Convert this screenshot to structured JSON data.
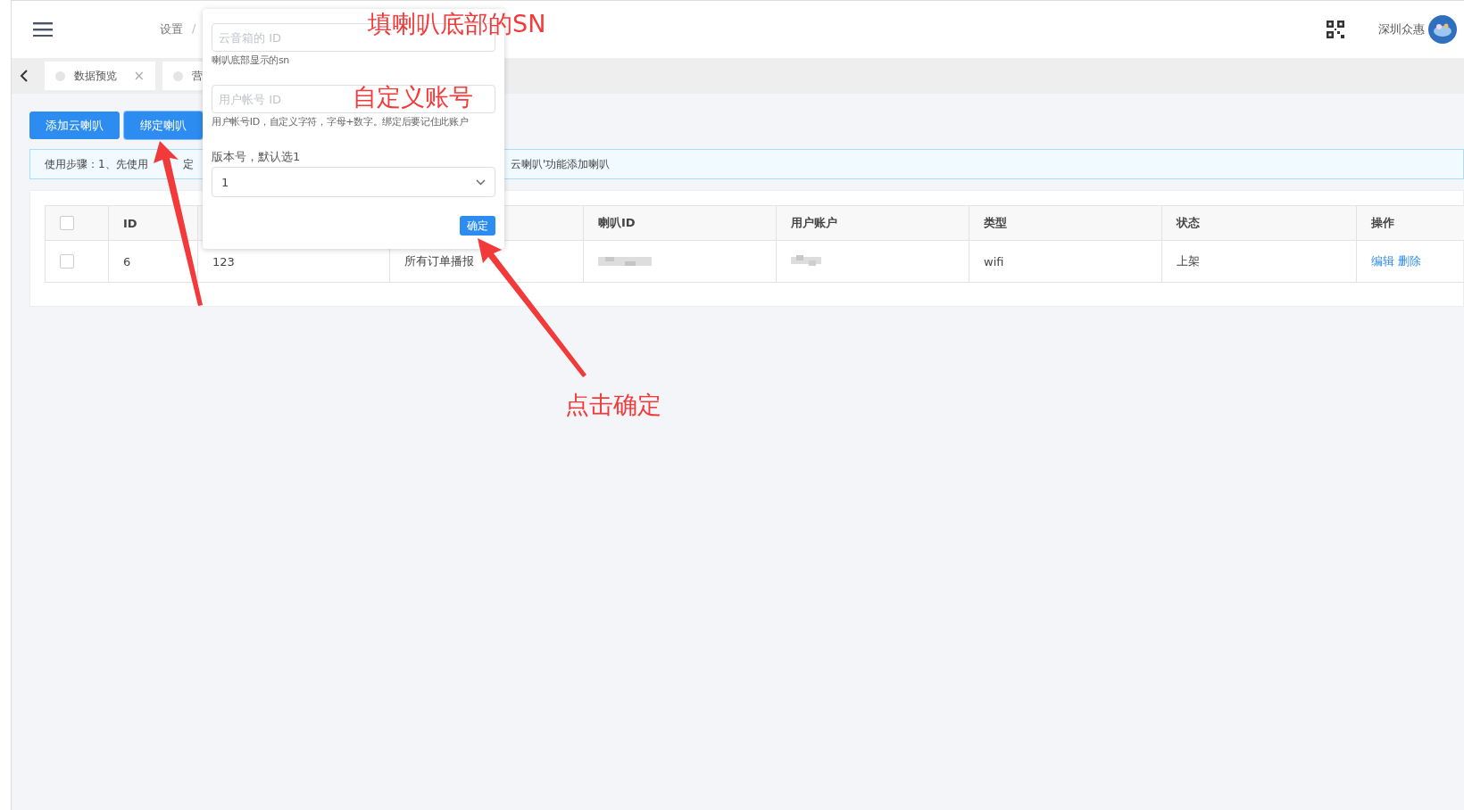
{
  "header": {
    "breadcrumb": [
      "设置",
      "/"
    ],
    "user": {
      "name": "深圳众惠"
    }
  },
  "tabs": [
    {
      "label": "数据预览",
      "selected": false,
      "close": "×"
    },
    {
      "label": "营",
      "selected": false
    }
  ],
  "toolbar": {
    "buttons": [
      "添加云喇叭",
      "绑定喇叭"
    ]
  },
  "alert": {
    "text_start": "使用步骤：1、先使用",
    "text_middle": "定",
    "text_end": "云喇叭'功能添加喇叭"
  },
  "table": {
    "all_checked": false,
    "columns": [
      "",
      "ID",
      "",
      "",
      "喇叭ID",
      "用户账户",
      "类型",
      "状态",
      "操作"
    ],
    "rows": [
      {
        "checked": false,
        "id": "6",
        "column_3": "123",
        "column_4": "所有订单播报",
        "speaker_id_redacted": true,
        "account_redacted": true,
        "type": "wifi",
        "status": "上架",
        "actions": [
          "编辑",
          "删除"
        ]
      }
    ]
  },
  "popover": {
    "fields": [
      {
        "placeholder": "云音箱的 ID",
        "hint": "喇叭底部显示的sn"
      },
      {
        "placeholder": "用户帐号 ID",
        "hint": "用户帐号ID，自定义字符，字母+数字。绑定后要记住此账户"
      }
    ],
    "select": {
      "label": "版本号，默认选1",
      "value": "1"
    },
    "confirm": "确定"
  },
  "annotations": [
    "填喇叭底部的SN",
    "自定义账号",
    "点击确定"
  ]
}
